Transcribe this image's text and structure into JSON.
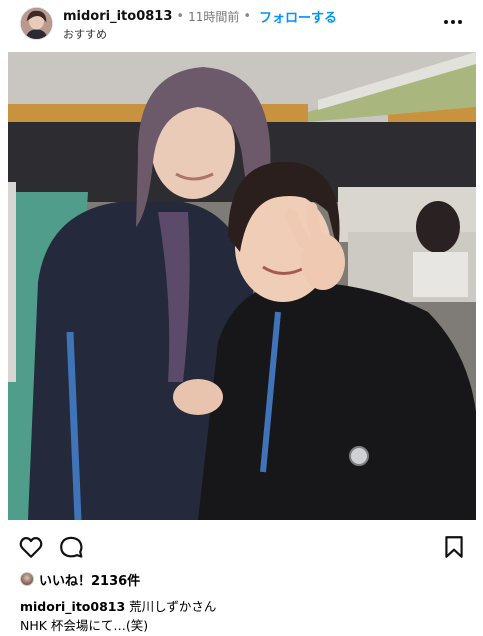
{
  "post": {
    "username": "midori_ito0813",
    "separator": "•",
    "time_ago": "11時間前",
    "follow_label": "フォローする",
    "subtitle": "おすすめ",
    "more_icon": "more-horizontal-icon"
  },
  "actions": {
    "like_icon": "heart-icon",
    "comment_icon": "comment-icon",
    "save_icon": "bookmark-icon"
  },
  "likes": {
    "text": "いいね！2136件"
  },
  "caption": {
    "username": "midori_ito0813",
    "line1": " 荒川しずかさん",
    "line2": "NHK 杯会場にて…(笑)"
  },
  "colors": {
    "link_blue": "#0095f6",
    "text": "#000000",
    "muted": "#777777"
  }
}
